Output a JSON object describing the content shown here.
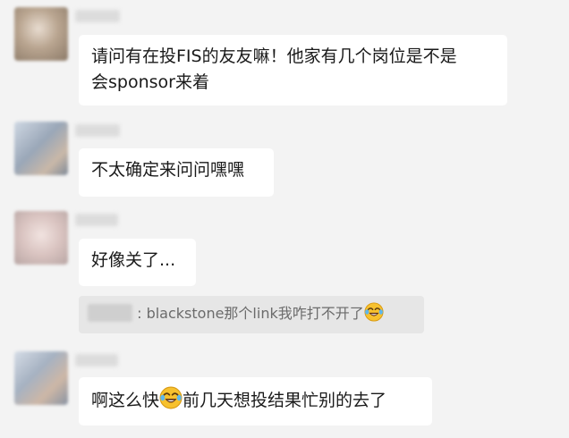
{
  "messages": [
    {
      "lines": [
        "请问有在投FIS的友友嘛！他家有几个岗位是不是",
        "会sponsor来着"
      ]
    },
    {
      "lines": [
        "不太确定来问问嘿嘿"
      ]
    },
    {
      "lines": [
        "好像关了..."
      ]
    },
    {
      "text_before": "啊这么快",
      "emoji": "laughing-tears-icon",
      "text_after": "前几天想投结果忙别的去了"
    }
  ],
  "quote": {
    "separator": ":",
    "text": "blackstone那个link我咋打不开了",
    "emoji": "laughing-tears-icon"
  }
}
